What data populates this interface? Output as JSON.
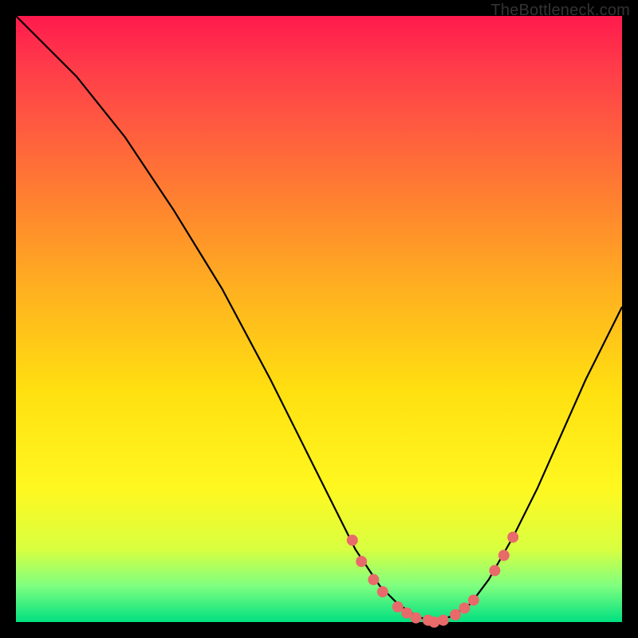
{
  "watermark": "TheBottleneck.com",
  "colors": {
    "background_black": "#000000",
    "gradient_top": "#ff1a4d",
    "gradient_bottom": "#00e080",
    "curve_stroke": "#000000",
    "marker_fill": "#e86a6a"
  },
  "chart_data": {
    "type": "line",
    "title": "",
    "xlabel": "",
    "ylabel": "",
    "xlim": [
      0,
      100
    ],
    "ylim": [
      0,
      100
    ],
    "series": [
      {
        "name": "bottleneck-curve",
        "x": [
          0,
          4,
          10,
          18,
          26,
          34,
          42,
          48,
          52,
          56,
          60,
          63,
          66,
          69,
          72,
          75,
          78,
          82,
          86,
          90,
          94,
          98,
          100
        ],
        "y": [
          100,
          96,
          90,
          80,
          68,
          55,
          40,
          28,
          20,
          12,
          6,
          3,
          1,
          0,
          1,
          3,
          7,
          14,
          22,
          31,
          40,
          48,
          52
        ]
      }
    ],
    "markers": [
      {
        "x": 55.5,
        "y": 13.5
      },
      {
        "x": 57.0,
        "y": 10.0
      },
      {
        "x": 59.0,
        "y": 7.0
      },
      {
        "x": 60.5,
        "y": 5.0
      },
      {
        "x": 63.0,
        "y": 2.5
      },
      {
        "x": 64.5,
        "y": 1.5
      },
      {
        "x": 66.0,
        "y": 0.7
      },
      {
        "x": 68.0,
        "y": 0.3
      },
      {
        "x": 69.0,
        "y": 0.0
      },
      {
        "x": 70.5,
        "y": 0.3
      },
      {
        "x": 72.5,
        "y": 1.2
      },
      {
        "x": 74.0,
        "y": 2.3
      },
      {
        "x": 75.5,
        "y": 3.6
      },
      {
        "x": 79.0,
        "y": 8.5
      },
      {
        "x": 80.5,
        "y": 11.0
      },
      {
        "x": 82.0,
        "y": 14.0
      }
    ]
  }
}
